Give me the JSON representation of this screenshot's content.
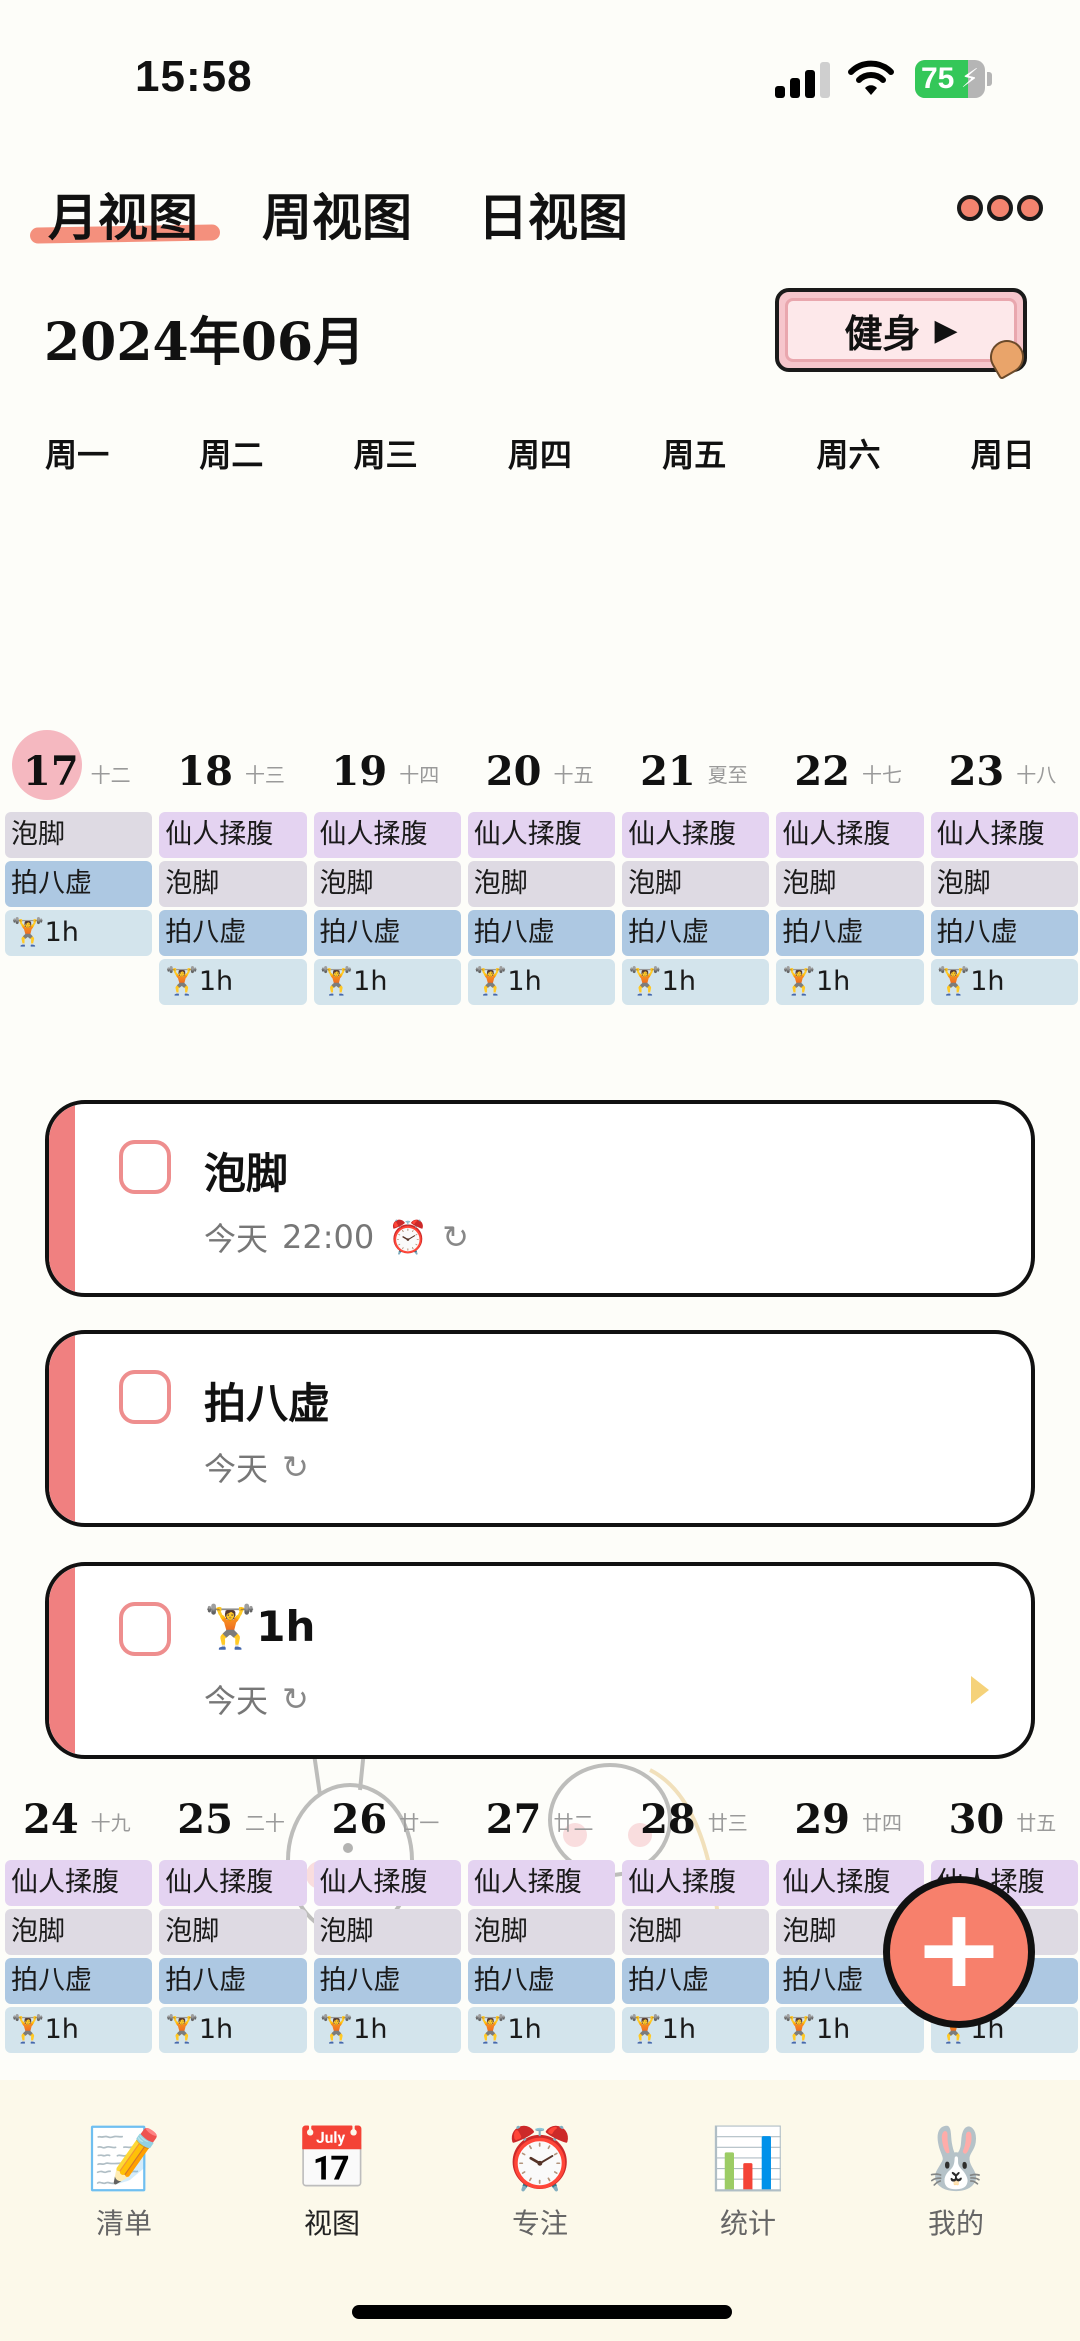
{
  "status_bar": {
    "time": "15:58",
    "battery_percent": "75",
    "battery_level": 0.75,
    "charging": true,
    "signal_bars": 3,
    "signal_max": 4
  },
  "view_tabs": [
    {
      "label": "月视图",
      "active": true
    },
    {
      "label": "周视图",
      "active": false
    },
    {
      "label": "日视图",
      "active": false
    }
  ],
  "header": {
    "month_title": "2024年06月",
    "category_button": "健身",
    "category_arrow": "▶"
  },
  "weekdays": [
    "周一",
    "周二",
    "周三",
    "周四",
    "周五",
    "周六",
    "周日"
  ],
  "colors": {
    "accent": "#f3846f",
    "today_circle": "#f5b8c0",
    "chip_purple": "#e4d3f1",
    "chip_gray": "#dedae3",
    "chip_blue": "#adc8e2",
    "chip_light": "#d3e4ec",
    "card_stripe": "#f08080",
    "fab": "#f7806c"
  },
  "weeks": [
    {
      "days": [
        {
          "date": "17",
          "lunar": "十二",
          "today": true,
          "events": [
            {
              "label": "泡脚",
              "color": "gray"
            },
            {
              "label": "拍八虚",
              "color": "blue"
            },
            {
              "label": "🏋1h",
              "color": "light"
            }
          ]
        },
        {
          "date": "18",
          "lunar": "十三",
          "events": [
            {
              "label": "仙人揉腹",
              "color": "purple"
            },
            {
              "label": "泡脚",
              "color": "gray"
            },
            {
              "label": "拍八虚",
              "color": "blue"
            },
            {
              "label": "🏋1h",
              "color": "light"
            }
          ]
        },
        {
          "date": "19",
          "lunar": "十四",
          "events": [
            {
              "label": "仙人揉腹",
              "color": "purple"
            },
            {
              "label": "泡脚",
              "color": "gray"
            },
            {
              "label": "拍八虚",
              "color": "blue"
            },
            {
              "label": "🏋1h",
              "color": "light"
            }
          ]
        },
        {
          "date": "20",
          "lunar": "十五",
          "events": [
            {
              "label": "仙人揉腹",
              "color": "purple"
            },
            {
              "label": "泡脚",
              "color": "gray"
            },
            {
              "label": "拍八虚",
              "color": "blue"
            },
            {
              "label": "🏋1h",
              "color": "light"
            }
          ]
        },
        {
          "date": "21",
          "lunar": "夏至",
          "events": [
            {
              "label": "仙人揉腹",
              "color": "purple"
            },
            {
              "label": "泡脚",
              "color": "gray"
            },
            {
              "label": "拍八虚",
              "color": "blue"
            },
            {
              "label": "🏋1h",
              "color": "light"
            }
          ]
        },
        {
          "date": "22",
          "lunar": "十七",
          "events": [
            {
              "label": "仙人揉腹",
              "color": "purple"
            },
            {
              "label": "泡脚",
              "color": "gray"
            },
            {
              "label": "拍八虚",
              "color": "blue"
            },
            {
              "label": "🏋1h",
              "color": "light"
            }
          ]
        },
        {
          "date": "23",
          "lunar": "十八",
          "events": [
            {
              "label": "仙人揉腹",
              "color": "purple"
            },
            {
              "label": "泡脚",
              "color": "gray"
            },
            {
              "label": "拍八虚",
              "color": "blue"
            },
            {
              "label": "🏋1h",
              "color": "light"
            }
          ]
        }
      ]
    },
    {
      "days": [
        {
          "date": "24",
          "lunar": "十九",
          "events": [
            {
              "label": "仙人揉腹",
              "color": "purple"
            },
            {
              "label": "泡脚",
              "color": "gray"
            },
            {
              "label": "拍八虚",
              "color": "blue"
            },
            {
              "label": "🏋1h",
              "color": "light"
            }
          ]
        },
        {
          "date": "25",
          "lunar": "二十",
          "events": [
            {
              "label": "仙人揉腹",
              "color": "purple"
            },
            {
              "label": "泡脚",
              "color": "gray"
            },
            {
              "label": "拍八虚",
              "color": "blue"
            },
            {
              "label": "🏋1h",
              "color": "light"
            }
          ]
        },
        {
          "date": "26",
          "lunar": "廿一",
          "events": [
            {
              "label": "仙人揉腹",
              "color": "purple"
            },
            {
              "label": "泡脚",
              "color": "gray"
            },
            {
              "label": "拍八虚",
              "color": "blue"
            },
            {
              "label": "🏋1h",
              "color": "light"
            }
          ]
        },
        {
          "date": "27",
          "lunar": "廿二",
          "events": [
            {
              "label": "仙人揉腹",
              "color": "purple"
            },
            {
              "label": "泡脚",
              "color": "gray"
            },
            {
              "label": "拍八虚",
              "color": "blue"
            },
            {
              "label": "🏋1h",
              "color": "light"
            }
          ]
        },
        {
          "date": "28",
          "lunar": "廿三",
          "events": [
            {
              "label": "仙人揉腹",
              "color": "purple"
            },
            {
              "label": "泡脚",
              "color": "gray"
            },
            {
              "label": "拍八虚",
              "color": "blue"
            },
            {
              "label": "🏋1h",
              "color": "light"
            }
          ]
        },
        {
          "date": "29",
          "lunar": "廿四",
          "events": [
            {
              "label": "仙人揉腹",
              "color": "purple"
            },
            {
              "label": "泡脚",
              "color": "gray"
            },
            {
              "label": "拍八虚",
              "color": "blue"
            },
            {
              "label": "🏋1h",
              "color": "light"
            }
          ]
        },
        {
          "date": "30",
          "lunar": "廿五",
          "events": [
            {
              "label": "仙人揉腹",
              "color": "purple"
            },
            {
              "label": "泡脚",
              "color": "gray"
            },
            {
              "label": "拍八虚",
              "color": "blue"
            },
            {
              "label": "🏋1h",
              "color": "light"
            }
          ]
        }
      ]
    }
  ],
  "tasks": [
    {
      "title": "泡脚",
      "date": "今天",
      "time": "22:00",
      "has_alarm": true,
      "repeat": true,
      "expand": false
    },
    {
      "title": "拍八虚",
      "date": "今天",
      "time": "",
      "has_alarm": false,
      "repeat": true,
      "expand": false
    },
    {
      "title": "🏋1h",
      "date": "今天",
      "time": "",
      "has_alarm": false,
      "repeat": true,
      "expand": true
    }
  ],
  "fab": {
    "icon": "plus-icon",
    "symbol": "+"
  },
  "bottom_nav": [
    {
      "label": "清单",
      "icon": "checklist-icon",
      "glyph": "📝",
      "active": false
    },
    {
      "label": "视图",
      "icon": "calendar-icon",
      "glyph": "📅",
      "active": true
    },
    {
      "label": "专注",
      "icon": "alarm-clock-icon",
      "glyph": "⏰",
      "active": false
    },
    {
      "label": "统计",
      "icon": "bar-chart-icon",
      "glyph": "📊",
      "active": false
    },
    {
      "label": "我的",
      "icon": "bunny-avatar-icon",
      "glyph": "🐰",
      "active": false
    }
  ]
}
